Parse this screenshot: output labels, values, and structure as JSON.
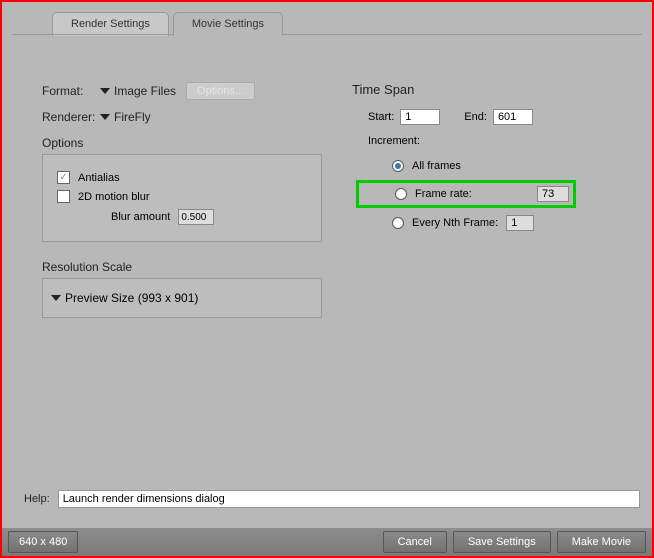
{
  "tabs": {
    "render": "Render Settings",
    "movie": "Movie Settings"
  },
  "format": {
    "label": "Format:",
    "value": "Image Files",
    "options_btn": "Options..."
  },
  "renderer": {
    "label": "Renderer:",
    "value": "FireFly"
  },
  "options": {
    "title": "Options",
    "antialias": "Antialias",
    "motion_blur": "2D motion blur",
    "blur_label": "Blur amount",
    "blur_value": "0.500"
  },
  "resolution": {
    "title": "Resolution Scale",
    "preview": "Preview Size (993 x 901)"
  },
  "timespan": {
    "title": "Time Span",
    "start_label": "Start:",
    "start_value": "1",
    "end_label": "End:",
    "end_value": "601",
    "increment_label": "Increment:",
    "all_frames": "All frames",
    "frame_rate": "Frame rate:",
    "frame_rate_value": "73",
    "every_nth": "Every Nth Frame:",
    "every_nth_value": "1"
  },
  "help": {
    "label": "Help:",
    "text": "Launch render dimensions dialog"
  },
  "bottom": {
    "dims": "640 x 480",
    "cancel": "Cancel",
    "save": "Save Settings",
    "make": "Make Movie"
  }
}
